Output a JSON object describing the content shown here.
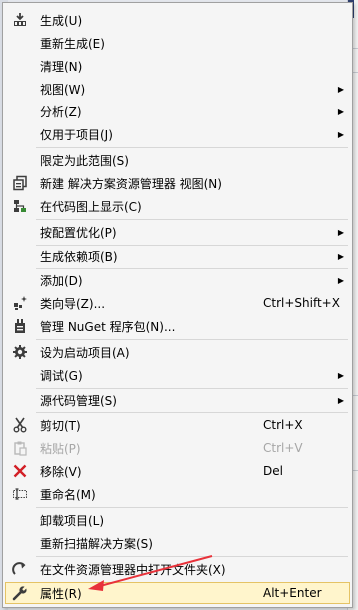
{
  "menu": {
    "items": [
      {
        "label": "生成(U)",
        "shortcut": "",
        "submenu": false,
        "icon": "build-icon",
        "disabled": false
      },
      {
        "label": "重新生成(E)",
        "shortcut": "",
        "submenu": false,
        "icon": "",
        "disabled": false
      },
      {
        "label": "清理(N)",
        "shortcut": "",
        "submenu": false,
        "icon": "",
        "disabled": false
      },
      {
        "label": "视图(W)",
        "shortcut": "",
        "submenu": true,
        "icon": "",
        "disabled": false
      },
      {
        "label": "分析(Z)",
        "shortcut": "",
        "submenu": true,
        "icon": "",
        "disabled": false
      },
      {
        "label": "仅用于项目(J)",
        "shortcut": "",
        "submenu": true,
        "icon": "",
        "disabled": false
      },
      {
        "label": "限定为此范围(S)",
        "shortcut": "",
        "submenu": false,
        "icon": "",
        "disabled": false
      },
      {
        "label": "新建 解决方案资源管理器 视图(N)",
        "shortcut": "",
        "submenu": false,
        "icon": "new-view-icon",
        "disabled": false
      },
      {
        "label": "在代码图上显示(C)",
        "shortcut": "",
        "submenu": false,
        "icon": "code-map-icon",
        "disabled": false
      },
      {
        "label": "按配置优化(P)",
        "shortcut": "",
        "submenu": true,
        "icon": "",
        "disabled": false
      },
      {
        "label": "生成依赖项(B)",
        "shortcut": "",
        "submenu": true,
        "icon": "",
        "disabled": false
      },
      {
        "label": "添加(D)",
        "shortcut": "",
        "submenu": true,
        "icon": "",
        "disabled": false
      },
      {
        "label": "类向导(Z)...",
        "shortcut": "Ctrl+Shift+X",
        "submenu": false,
        "icon": "class-wizard-icon",
        "disabled": false
      },
      {
        "label": "管理 NuGet 程序包(N)...",
        "shortcut": "",
        "submenu": false,
        "icon": "nuget-icon",
        "disabled": false
      },
      {
        "label": "设为启动项目(A)",
        "shortcut": "",
        "submenu": false,
        "icon": "gear-icon",
        "disabled": false
      },
      {
        "label": "调试(G)",
        "shortcut": "",
        "submenu": true,
        "icon": "",
        "disabled": false
      },
      {
        "label": "源代码管理(S)",
        "shortcut": "",
        "submenu": true,
        "icon": "",
        "disabled": false
      },
      {
        "label": "剪切(T)",
        "shortcut": "Ctrl+X",
        "submenu": false,
        "icon": "cut-icon",
        "disabled": false
      },
      {
        "label": "粘贴(P)",
        "shortcut": "Ctrl+V",
        "submenu": false,
        "icon": "paste-icon",
        "disabled": true
      },
      {
        "label": "移除(V)",
        "shortcut": "Del",
        "submenu": false,
        "icon": "remove-icon",
        "disabled": false
      },
      {
        "label": "重命名(M)",
        "shortcut": "",
        "submenu": false,
        "icon": "rename-icon",
        "disabled": false
      },
      {
        "label": "卸载项目(L)",
        "shortcut": "",
        "submenu": false,
        "icon": "",
        "disabled": false
      },
      {
        "label": "重新扫描解决方案(S)",
        "shortcut": "",
        "submenu": false,
        "icon": "",
        "disabled": false
      },
      {
        "label": "在文件资源管理器中打开文件夹(X)",
        "shortcut": "",
        "submenu": false,
        "icon": "refresh-arrow-icon",
        "disabled": false
      },
      {
        "label": "属性(R)",
        "shortcut": "Alt+Enter",
        "submenu": false,
        "icon": "wrench-icon",
        "disabled": false,
        "highlighted": true
      }
    ]
  },
  "colors": {
    "menu_bg": "#f5f5f5",
    "highlight_bg": "#fff5cc",
    "highlight_border": "#e5c365",
    "disabled_text": "#a6a6a6",
    "annotation_arrow": "#e8323a"
  }
}
